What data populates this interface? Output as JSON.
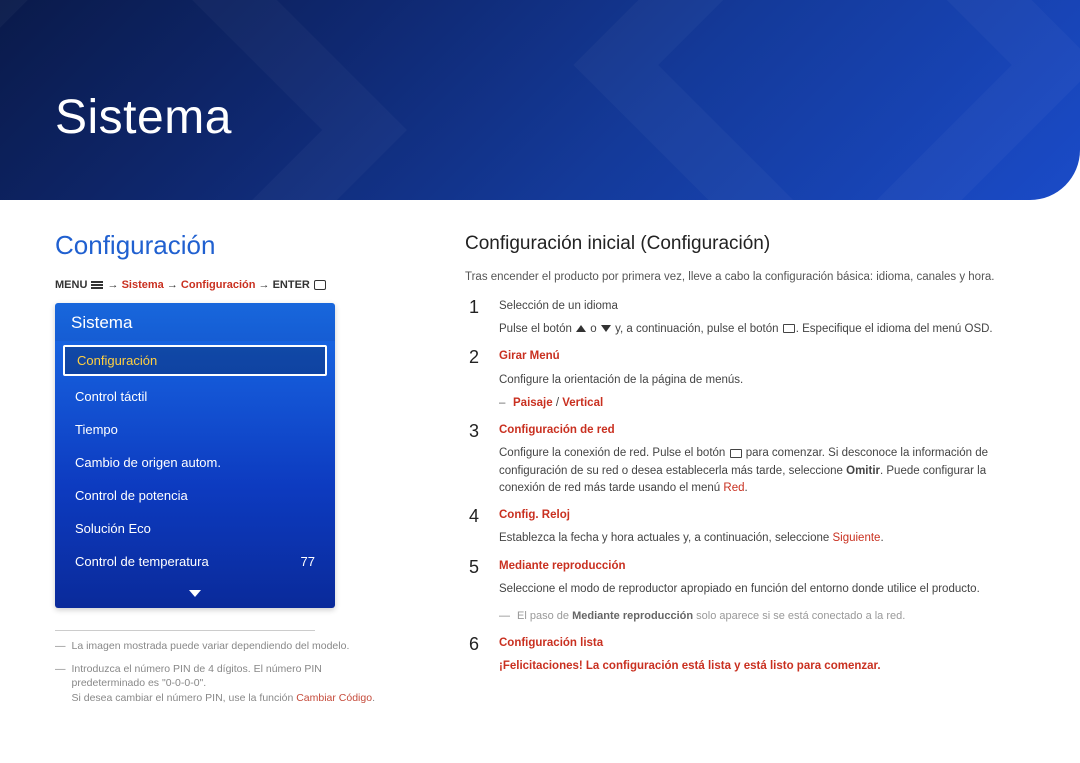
{
  "hero": {
    "title": "Sistema"
  },
  "left": {
    "section_title": "Configuración",
    "breadcrumb": {
      "menu": "MENU",
      "arrow": "→",
      "path1": "Sistema",
      "path2": "Configuración",
      "enter": "ENTER"
    },
    "osd": {
      "title": "Sistema",
      "items": [
        {
          "label": "Configuración",
          "selected": true
        },
        {
          "label": "Control táctil"
        },
        {
          "label": "Tiempo"
        },
        {
          "label": "Cambio de origen autom."
        },
        {
          "label": "Control de potencia"
        },
        {
          "label": "Solución Eco"
        },
        {
          "label": "Control de temperatura",
          "value": "77"
        }
      ]
    },
    "footnotes": [
      {
        "text": "La imagen mostrada puede variar dependiendo del modelo."
      },
      {
        "text_a": "Introduzca el número PIN de 4 dígitos. El número PIN predeterminado es \"0-0-0-0\".",
        "text_b": "Si desea cambiar el número PIN, use la función ",
        "text_c": "Cambiar Código",
        "text_d": "."
      }
    ]
  },
  "right": {
    "subheading": "Configuración inicial (Configuración)",
    "intro": "Tras encender el producto por primera vez, lleve a cabo la configuración básica: idioma, canales y hora.",
    "steps": [
      {
        "num": "1",
        "lines": [
          {
            "plain": "Selección de un idioma"
          },
          {
            "html_parts": [
              "Pulse el botón ",
              "{tri-up}",
              " o ",
              "{tri-down}",
              " y, a continuación, pulse el botón ",
              "{icon}",
              ". Especifique el idioma del menú OSD."
            ]
          }
        ]
      },
      {
        "num": "2",
        "lines": [
          {
            "red": "Girar Menú"
          },
          {
            "plain": "Configure la orientación de la página de menús."
          },
          {
            "sub_red": "Paisaje",
            "sub_sep": " / ",
            "sub_red2": "Vertical"
          }
        ]
      },
      {
        "num": "3",
        "lines": [
          {
            "red": "Configuración de red"
          },
          {
            "html_parts": [
              "Configure la conexión de red. Pulse el botón ",
              "{icon}",
              " para comenzar. Si desconoce la información de configuración de su red o desea establecerla más tarde, seleccione "
            ],
            "bold_after": "Omitir",
            "tail_a": ". Puede configurar la conexión de red más tarde usando el menú ",
            "tail_red": "Red",
            "tail_b": "."
          }
        ]
      },
      {
        "num": "4",
        "lines": [
          {
            "red": "Config. Reloj"
          },
          {
            "plain_a": "Establezca la fecha y hora actuales y, a continuación, seleccione ",
            "red_inline": "Siguiente",
            "plain_b": "."
          }
        ]
      },
      {
        "num": "5",
        "lines": [
          {
            "red": "Mediante reproducción"
          },
          {
            "plain": "Seleccione el modo de reproductor apropiado en función del entorno donde utilice el producto."
          }
        ],
        "post_note": {
          "a": "El paso de ",
          "b": "Mediante reproducción",
          "c": " solo aparece si se está conectado a la red."
        }
      },
      {
        "num": "6",
        "lines": [
          {
            "red": "Configuración lista"
          },
          {
            "all_red": "¡Felicitaciones! La configuración está lista y está listo para comenzar."
          }
        ]
      }
    ]
  }
}
